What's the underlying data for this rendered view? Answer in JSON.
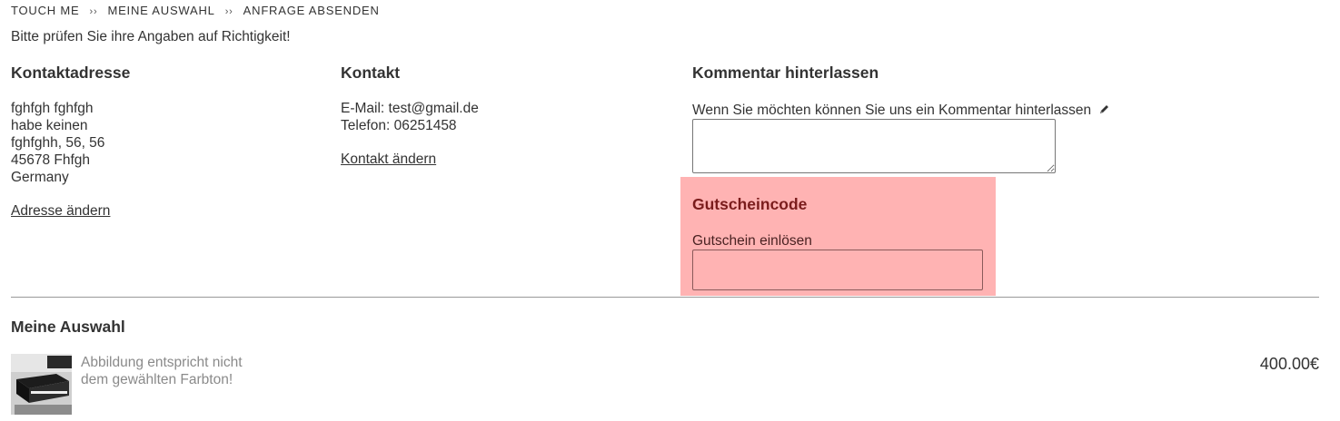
{
  "breadcrumb": {
    "items": [
      "TOUCH ME",
      "MEINE AUSWAHL",
      "ANFRAGE ABSENDEN"
    ],
    "separator": "››"
  },
  "notice": "Bitte prüfen Sie ihre Angaben auf Richtigkeit!",
  "contact_address": {
    "title": "Kontaktadresse",
    "lines": [
      "fghfgh fghfgh",
      "habe keinen",
      "fghfghh, 56, 56",
      "45678 Fhfgh",
      "Germany"
    ],
    "change_link": "Adresse ändern"
  },
  "contact": {
    "title": "Kontakt",
    "email_line": "E-Mail: test@gmail.de",
    "phone_line": "Telefon: 06251458",
    "change_link": "Kontakt ändern"
  },
  "comment": {
    "title": "Kommentar hinterlassen",
    "label": "Wenn Sie möchten können Sie uns ein Kommentar hinterlassen",
    "label_icon": "pencil-icon",
    "value": ""
  },
  "voucher": {
    "title": "Gutscheincode",
    "label": "Gutschein einlösen",
    "value": "",
    "panel_color": "#ffb3b3",
    "title_color": "#7a1c1c"
  },
  "selection": {
    "title": "Meine Auswahl",
    "items": [
      {
        "description_lines": [
          "Abbildung entspricht nicht",
          "dem gewählten Farbton!"
        ],
        "price": "400.00€"
      }
    ]
  }
}
